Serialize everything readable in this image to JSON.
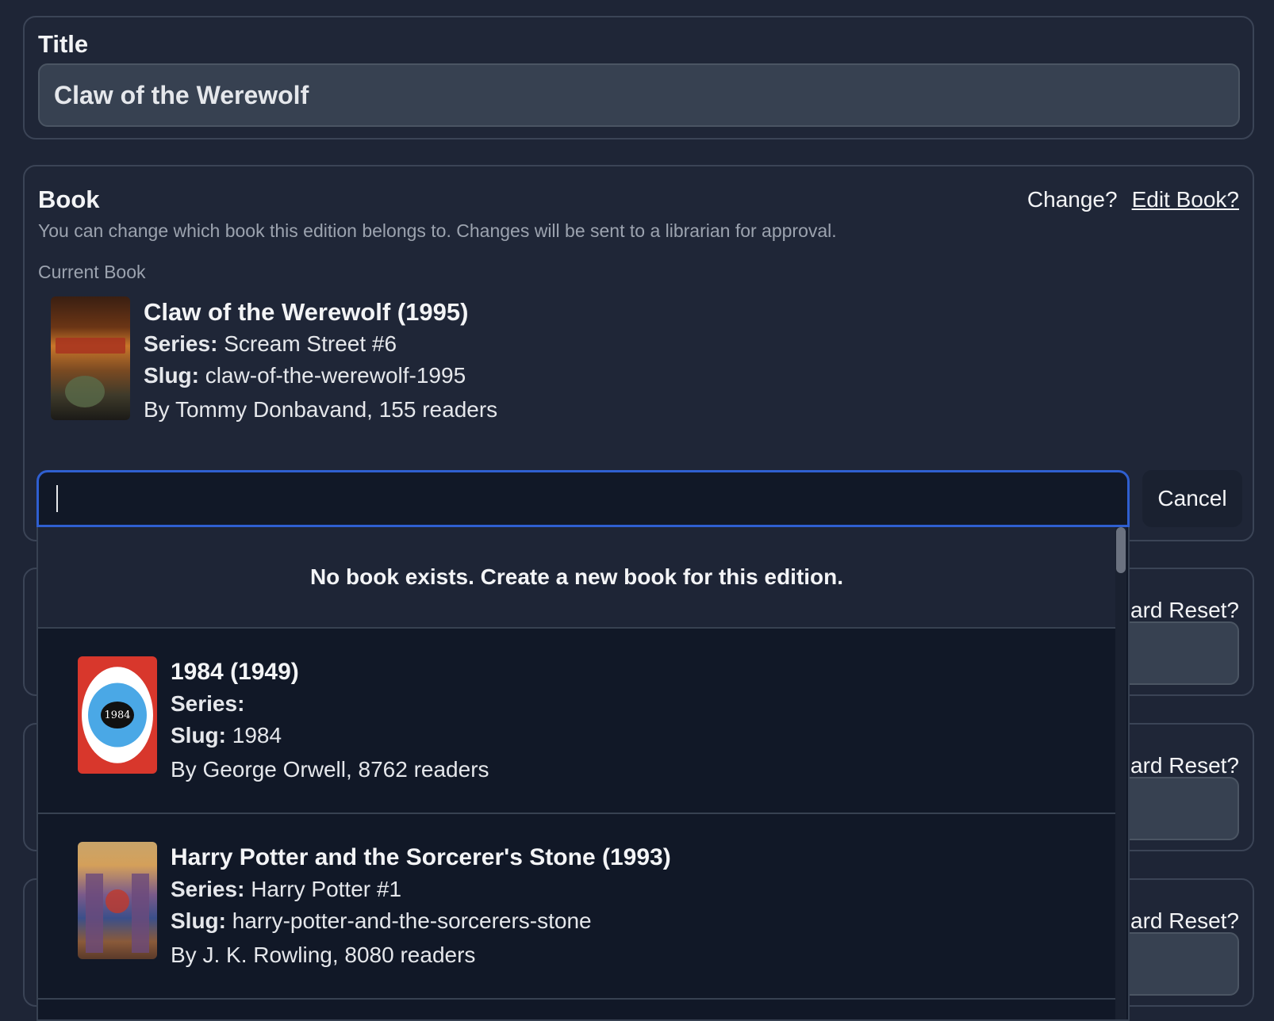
{
  "title_card": {
    "label": "Title",
    "value": "Claw of the Werewolf"
  },
  "book_card": {
    "heading": "Book",
    "change_label": "Change?",
    "edit_label": "Edit Book?",
    "description": "You can change which book this edition belongs to. Changes will be sent to a librarian for approval.",
    "current_label": "Current Book",
    "current": {
      "name": "Claw of the Werewolf (1995)",
      "series_label": "Series:",
      "series": "Scream Street #6",
      "slug_label": "Slug:",
      "slug": "claw-of-the-werewolf-1995",
      "byline": "By Tommy Donbavand, 155 readers"
    }
  },
  "search": {
    "value": "",
    "cancel_label": "Cancel"
  },
  "dropdown": {
    "no_book": "No book exists. Create a new book for this edition.",
    "results": [
      {
        "name": "1984 (1949)",
        "series_label": "Series:",
        "series": "",
        "slug_label": "Slug:",
        "slug": "1984",
        "byline": "By George Orwell, 8762 readers",
        "cover_text": "1984"
      },
      {
        "name": "Harry Potter and the Sorcerer's Stone (1993)",
        "series_label": "Series:",
        "series": "Harry Potter #1",
        "slug_label": "Slug:",
        "slug": "harry-potter-and-the-sorcerers-stone",
        "byline": "By J. K. Rowling, 8080 readers"
      }
    ]
  },
  "background_cards": [
    {
      "reset_label": "ard Reset?"
    },
    {
      "reset_label": "ard Reset?"
    },
    {
      "reset_label": "ard Reset?"
    }
  ],
  "colors": {
    "accent_border": "#2f5fd0",
    "background": "#1e2536"
  }
}
